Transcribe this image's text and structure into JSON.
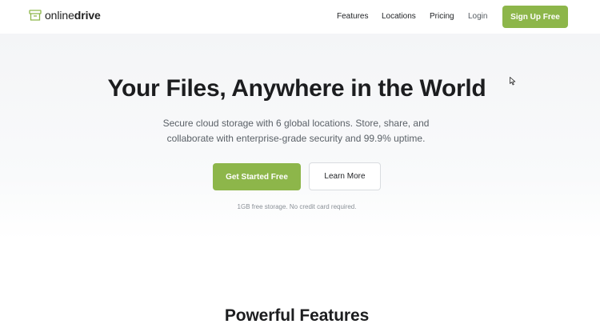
{
  "brand": {
    "name_light": "online",
    "name_bold": "drive",
    "logo_icon": "archive-box-icon",
    "accent_color": "#8db64a"
  },
  "nav": {
    "items": [
      {
        "label": "Features"
      },
      {
        "label": "Locations"
      },
      {
        "label": "Pricing"
      },
      {
        "label": "Login"
      }
    ],
    "cta_label": "Sign Up Free"
  },
  "hero": {
    "title": "Your Files, Anywhere in the World",
    "subtitle": "Secure cloud storage with 6 global locations. Store, share, and collaborate with enterprise-grade security and 99.9% uptime.",
    "primary_cta": "Get Started Free",
    "secondary_cta": "Learn More",
    "note": "1GB free storage. No credit card required."
  },
  "features": {
    "heading": "Powerful Features"
  },
  "cursor": {
    "icon": "mouse-pointer-icon"
  }
}
